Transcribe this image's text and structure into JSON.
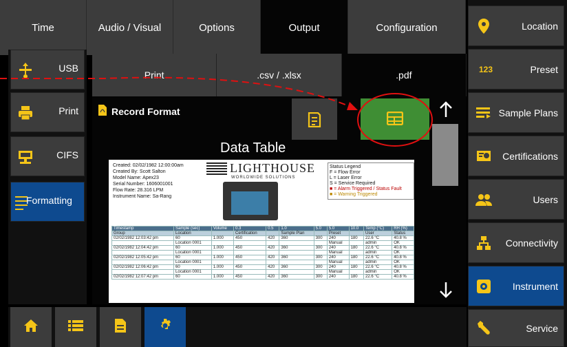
{
  "top_tabs": {
    "time": "Time",
    "audio_visual": "Audio / Visual",
    "options": "Options",
    "output": "Output",
    "configuration": "Configuration"
  },
  "right_menu": {
    "location": "Location",
    "preset": "Preset",
    "preset_badge": "123",
    "sample_plans": "Sample Plans",
    "certifications": "Certifications",
    "users": "Users",
    "connectivity": "Connectivity",
    "instrument": "Instrument",
    "service": "Service"
  },
  "left_menu": {
    "usb": "USB",
    "print": "Print",
    "cifs": "CIFS",
    "formatting": "Formatting"
  },
  "sub_tabs": {
    "print": "Print",
    "csv": ".csv / .xlsx",
    "pdf": ".pdf"
  },
  "panel": {
    "record_format": "Record Format",
    "data_table_title": "Data Table"
  },
  "preview": {
    "meta": [
      "Created: 02/02/1982 12:00:00am",
      "Created By: Scott Salton",
      "Model Name: Apex23",
      "Serial Number: 1606001001",
      "Flow Rate: 28.316 LPM",
      "Instrument Name: Sa-Rang"
    ],
    "logo": "LIGHTHOUSE",
    "logo_sub": "WORLDWIDE SOLUTIONS",
    "legend": [
      "Status Legend",
      "F = Flow Error",
      "L = Laser Error",
      "S = Service Required",
      "■ = Alarm Triggered / Status Fault",
      "■ = Warning Triggered"
    ],
    "header_row1": [
      "Timestamp",
      "Sample (sec)",
      "Volume",
      "0.3",
      "0.5",
      "1.0",
      "5.0",
      "5.0",
      "10.0",
      "Temp (°C)",
      "RH (%)"
    ],
    "header_row2": [
      "Group",
      "Location",
      "",
      "Certification",
      "",
      "Sample Plan",
      "",
      "Preset",
      "",
      "User",
      "Status"
    ],
    "rows": [
      [
        "02/02/1982 12:03:42 pm",
        "60",
        "1.000",
        "450",
        "420",
        "360",
        "300",
        "240",
        "180",
        "22.6 °C",
        "40.8 %"
      ],
      [
        "",
        "Location 0001",
        "",
        "",
        "",
        "",
        "",
        "Manual",
        "",
        "admin",
        "OK"
      ],
      [
        "02/02/1982 12:04:42 pm",
        "60",
        "1.000",
        "450",
        "420",
        "360",
        "300",
        "240",
        "180",
        "22.6 °C",
        "40.8 %"
      ],
      [
        "",
        "Location 0001",
        "",
        "",
        "",
        "",
        "",
        "Manual",
        "",
        "admin",
        "OK"
      ],
      [
        "02/02/1982 12:05:42 pm",
        "60",
        "1.000",
        "450",
        "420",
        "360",
        "300",
        "240",
        "180",
        "22.6 °C",
        "40.8 %"
      ],
      [
        "",
        "Location 0001",
        "",
        "",
        "",
        "",
        "",
        "Manual",
        "",
        "admin",
        "OK"
      ],
      [
        "02/02/1982 12:06:42 pm",
        "60",
        "1.000",
        "450",
        "420",
        "360",
        "300",
        "240",
        "180",
        "22.6 °C",
        "40.8 %"
      ],
      [
        "",
        "Location 0001",
        "",
        "",
        "",
        "",
        "",
        "Manual",
        "",
        "admin",
        "OK"
      ],
      [
        "02/02/1982 12:07:42 pm",
        "60",
        "1.000",
        "450",
        "420",
        "360",
        "300",
        "240",
        "180",
        "22.6 °C",
        "40.8 %"
      ]
    ]
  },
  "colors": {
    "accent_blue": "#0e4a8f",
    "icon_yellow": "#f5c518",
    "active_green": "#3f8e34",
    "annotation_red": "#e01010"
  },
  "icons": {
    "home": "home-icon",
    "list": "list-icon",
    "document": "document-icon",
    "settings": "gear-icon"
  }
}
